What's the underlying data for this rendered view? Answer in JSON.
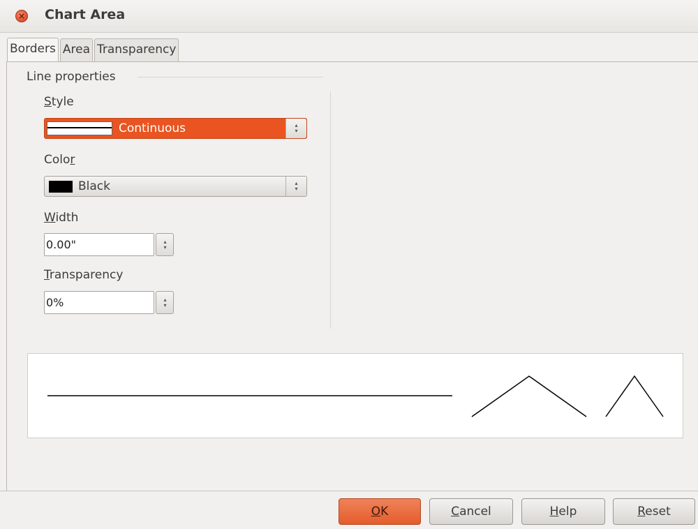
{
  "window": {
    "title": "Chart Area",
    "close_icon": "×"
  },
  "tabs": [
    {
      "label": "Borders",
      "active": true
    },
    {
      "label": "Area",
      "active": false
    },
    {
      "label": "Transparency",
      "active": false
    }
  ],
  "line_properties": {
    "section_title": "Line properties",
    "style": {
      "label_first": "S",
      "label_rest": "tyle",
      "value": "Continuous"
    },
    "color": {
      "label_start": "Colo",
      "label_underline": "r",
      "value": "Black",
      "swatch": "#000000"
    },
    "width": {
      "label_first": "W",
      "label_rest": "idth",
      "value": "0.00\""
    },
    "transparency": {
      "label_first": "T",
      "label_rest": "ransparency",
      "value": "0%"
    }
  },
  "buttons": {
    "ok": {
      "first": "O",
      "rest": "K"
    },
    "cancel": {
      "first": "C",
      "rest": "ancel"
    },
    "help": {
      "first": "H",
      "rest": "elp"
    },
    "reset": {
      "first": "R",
      "rest": "eset"
    }
  },
  "colors": {
    "accent": "#e95420",
    "window_bg": "#f1f0ee"
  }
}
